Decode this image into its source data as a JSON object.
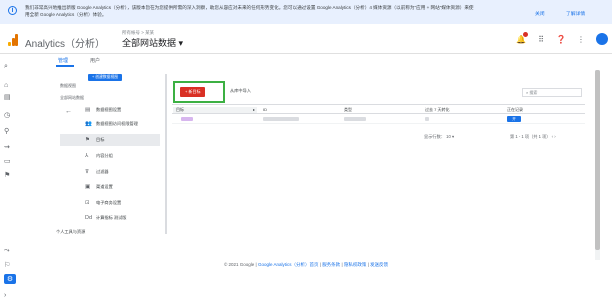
{
  "banner": {
    "text": "我们非常高兴地推出新版 Google Analytics（分析），该版本旨在为您提供所需的深入洞察，助您从容应对未来的任何形势变化。您可以通过设置 Google Analytics（分析）4 媒体资源（以前称为\"应用 + 网站\"媒体资源）来使用全新 Google Analytics（分析）体验。",
    "link_close": "关闭",
    "link_more": "了解详情"
  },
  "header": {
    "app_title": "Analytics（分析）",
    "account_line": "所有帐号 > 某某",
    "property": "全部网站数据"
  },
  "tabs": [
    {
      "label": "管理"
    },
    {
      "label": "用户"
    }
  ],
  "account_col": {
    "label": "数据视图",
    "create_label": "+ 创建数据视图",
    "view_name": "全部网站数据"
  },
  "menu": [
    {
      "icon": "settings-icon",
      "glyph": "▤",
      "label": "数据视图设置"
    },
    {
      "icon": "users-icon",
      "glyph": "👥",
      "label": "数据视图访问权限管理"
    },
    {
      "icon": "flag-icon",
      "glyph": "⚑",
      "label": "目标"
    },
    {
      "icon": "grouping-icon",
      "glyph": "⅄",
      "label": "内容分组"
    },
    {
      "icon": "filter-icon",
      "glyph": "⊽",
      "label": "过滤器"
    },
    {
      "icon": "channel-icon",
      "glyph": "▣",
      "label": "渠道设置"
    },
    {
      "icon": "cart-icon",
      "glyph": "⊡",
      "label": "电子商务设置"
    },
    {
      "icon": "calc-icon",
      "glyph": "Dd",
      "label": "计算指标 测试版"
    },
    {
      "icon": "none",
      "glyph": "",
      "label": "个人工具与资源"
    }
  ],
  "toolbar": {
    "add_label": "+ 新目标",
    "import_label": "从库中导入",
    "search_placeholder": "搜索"
  },
  "table": {
    "headers": [
      "目标",
      "ID",
      "类型",
      "过去 7 天转化",
      "正在记录"
    ],
    "toggle_label": "开"
  },
  "pager": {
    "rows_label": "显示行数：",
    "rows_value": "10 ▾",
    "range": "第 1 - 1 项（共 1 项）"
  },
  "footer": {
    "copyright": "© 2021 Google |",
    "home": "Google Analytics（分析）首页",
    "terms": "服务条款",
    "privacy": "隐私权政策",
    "feedback": "发送反馈"
  },
  "colors": {
    "accent": "#1a73e8",
    "highlight_box": "#3cb043",
    "add_button": "#d93025"
  }
}
